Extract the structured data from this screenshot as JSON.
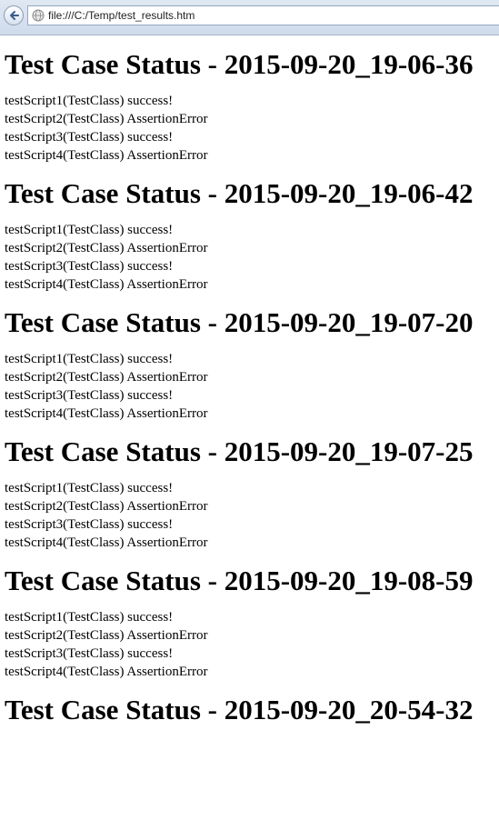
{
  "browser": {
    "url": "file:///C:/Temp/test_results.htm"
  },
  "page": {
    "sections": [
      {
        "heading": "Test Case Status - 2015-09-20_19-06-36",
        "results": [
          "testScript1(TestClass) success!",
          "testScript2(TestClass) AssertionError",
          "testScript3(TestClass) success!",
          "testScript4(TestClass) AssertionError"
        ]
      },
      {
        "heading": "Test Case Status - 2015-09-20_19-06-42",
        "results": [
          "testScript1(TestClass) success!",
          "testScript2(TestClass) AssertionError",
          "testScript3(TestClass) success!",
          "testScript4(TestClass) AssertionError"
        ]
      },
      {
        "heading": "Test Case Status - 2015-09-20_19-07-20",
        "results": [
          "testScript1(TestClass) success!",
          "testScript2(TestClass) AssertionError",
          "testScript3(TestClass) success!",
          "testScript4(TestClass) AssertionError"
        ]
      },
      {
        "heading": "Test Case Status - 2015-09-20_19-07-25",
        "results": [
          "testScript1(TestClass) success!",
          "testScript2(TestClass) AssertionError",
          "testScript3(TestClass) success!",
          "testScript4(TestClass) AssertionError"
        ]
      },
      {
        "heading": "Test Case Status - 2015-09-20_19-08-59",
        "results": [
          "testScript1(TestClass) success!",
          "testScript2(TestClass) AssertionError",
          "testScript3(TestClass) success!",
          "testScript4(TestClass) AssertionError"
        ]
      },
      {
        "heading": "Test Case Status - 2015-09-20_20-54-32",
        "results": []
      }
    ]
  }
}
